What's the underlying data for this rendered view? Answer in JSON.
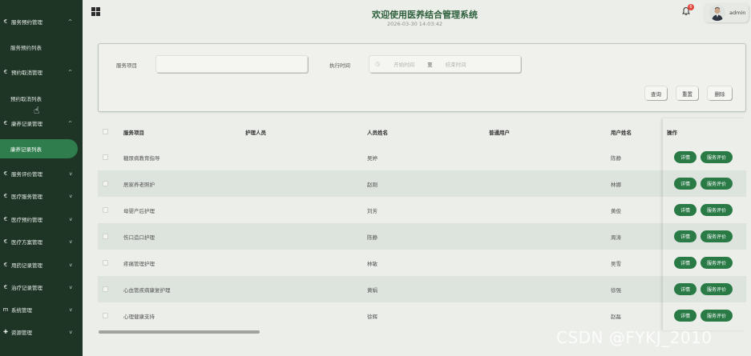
{
  "sidebar": {
    "groups": [
      {
        "label": "服务预约管理",
        "icon": "€",
        "chevron": "^"
      },
      {
        "label": "预约取消管理",
        "icon": "€",
        "chevron": "^"
      },
      {
        "label": "康养记录管理",
        "icon": "€",
        "chevron": "^"
      },
      {
        "label": "服务评价管理",
        "icon": "€",
        "chevron": "v"
      },
      {
        "label": "医疗服务管理",
        "icon": "€",
        "chevron": "v"
      },
      {
        "label": "医疗预约管理",
        "icon": "€",
        "chevron": "v"
      },
      {
        "label": "医疗方案管理",
        "icon": "€",
        "chevron": "v"
      },
      {
        "label": "用药记录管理",
        "icon": "€",
        "chevron": "v"
      },
      {
        "label": "治疗记录管理",
        "icon": "€",
        "chevron": "v"
      },
      {
        "label": "系统管理",
        "icon": "m",
        "chevron": "v"
      },
      {
        "label": "资源管理",
        "icon": "✚",
        "chevron": "v"
      }
    ],
    "subs": [
      {
        "label": "服务预约列表"
      },
      {
        "label": "预约取消列表"
      },
      {
        "label": "康养记录列表"
      }
    ]
  },
  "header": {
    "title": "欢迎使用医养结合管理系统",
    "datetime": "2026-03-30 14:03:42",
    "badge": "6",
    "username": "admin"
  },
  "search": {
    "service_label": "服务项目",
    "time_label": "执行时间",
    "start_placeholder": "开始时间",
    "to": "至",
    "end_placeholder": "结束时间",
    "query": "查询",
    "reset": "重置",
    "delete": "删除"
  },
  "table": {
    "headers": [
      "服务项目",
      "护理人员",
      "人员姓名",
      "普通用户",
      "用户姓名",
      "操作"
    ],
    "rows": [
      {
        "service": "糖尿病教育指导",
        "staff_name": "吴婷",
        "user_name": "陈静"
      },
      {
        "service": "居家养老照护",
        "staff_name": "赵刚",
        "user_name": "林娜"
      },
      {
        "service": "母婴产后护理",
        "staff_name": "刘芳",
        "user_name": "黄俊"
      },
      {
        "service": "伤口造口护理",
        "staff_name": "陈静",
        "user_name": "周涛"
      },
      {
        "service": "疼痛管理护理",
        "staff_name": "林敏",
        "user_name": "吴雪"
      },
      {
        "service": "心血管疾病康复护理",
        "staff_name": "黄娟",
        "user_name": "徐强"
      },
      {
        "service": "心理健康支持",
        "staff_name": "徐辉",
        "user_name": "赵磊"
      }
    ],
    "detail": "详情",
    "review": "服务评价"
  },
  "watermark": "CSDN @FYKJ_2010",
  "colors": {
    "sidebar": "#1e3526",
    "accent": "#2a7a46",
    "active": "#2f7d4d"
  }
}
